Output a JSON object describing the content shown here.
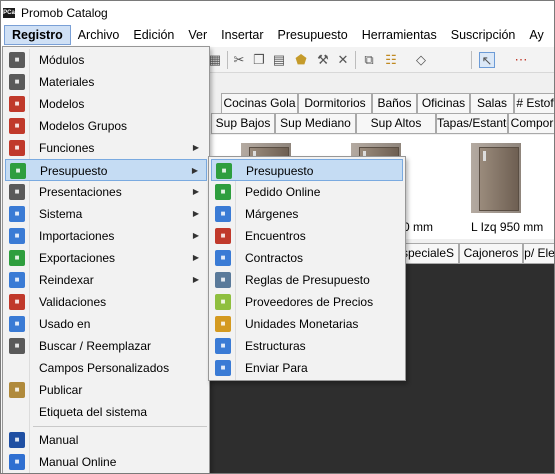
{
  "app": {
    "title": "Promob Catalog",
    "logo_text": "PCa"
  },
  "menubar": [
    "Registro",
    "Archivo",
    "Edición",
    "Ver",
    "Insertar",
    "Presupuesto",
    "Herramientas",
    "Suscripción",
    "Ay"
  ],
  "tabs_row1": [
    "Cocinas Gola",
    "Dormitorios",
    "Baños",
    "Oficinas",
    "Salas",
    "# Estof"
  ],
  "tabs_row2": [
    "Sup Bajos",
    "Sup Mediano",
    "Sup Altos",
    "Tapas/Estantes",
    "Compor"
  ],
  "tabs_row3": [
    "specialeS",
    "Cajoneros",
    "p/ Ele"
  ],
  "thumbs": {
    "label_partial": "0 mm",
    "label_right": "L Izq 950 mm"
  },
  "registro_menu": [
    {
      "label": "Módulos",
      "icon": "modules-icon",
      "color": "#5a5a5a"
    },
    {
      "label": "Materiales",
      "icon": "materials-icon",
      "color": "#5a5a5a"
    },
    {
      "label": "Modelos",
      "icon": "models-icon",
      "color": "#c0392b"
    },
    {
      "label": "Modelos Grupos",
      "icon": "model-groups-icon",
      "color": "#c0392b"
    },
    {
      "label": "Funciones",
      "icon": "functions-icon",
      "color": "#c0392b",
      "submenu": true
    },
    {
      "label": "Presupuesto",
      "icon": "budget-icon",
      "color": "#2e9e3e",
      "submenu": true,
      "highlighted": true
    },
    {
      "label": "Presentaciones",
      "icon": "presentations-icon",
      "color": "#5a5a5a",
      "submenu": true
    },
    {
      "label": "Sistema",
      "icon": "system-gear-icon",
      "color": "#3a7bd5",
      "submenu": true
    },
    {
      "label": "Importaciones",
      "icon": "import-icon",
      "color": "#3a7bd5",
      "submenu": true
    },
    {
      "label": "Exportaciones",
      "icon": "export-icon",
      "color": "#2e9e3e",
      "submenu": true
    },
    {
      "label": "Reindexar",
      "icon": "reindex-icon",
      "color": "#3a7bd5",
      "submenu": true
    },
    {
      "label": "Validaciones",
      "icon": "validations-icon",
      "color": "#c0392b"
    },
    {
      "label": "Usado en",
      "icon": "used-in-icon",
      "color": "#3a7bd5"
    },
    {
      "label": "Buscar / Reemplazar",
      "icon": "search-replace-icon",
      "color": "#5a5a5a"
    },
    {
      "label": "Campos Personalizados",
      "icon": "",
      "color": ""
    },
    {
      "label": "Publicar",
      "icon": "publish-icon",
      "color": "#b08a3c"
    },
    {
      "label": "Etiqueta del sistema",
      "icon": "",
      "color": ""
    },
    {
      "label": "Manual",
      "icon": "manual-book-icon",
      "color": "#1f4fa3",
      "sep_before": true
    },
    {
      "label": "Manual Online",
      "icon": "help-icon",
      "color": "#2f6fd1"
    }
  ],
  "presupuesto_submenu": [
    {
      "label": "Presupuesto",
      "icon": "budget-icon",
      "color": "#2e9e3e",
      "highlighted": true
    },
    {
      "label": "Pedido Online",
      "icon": "online-order-icon",
      "color": "#2e9e3e"
    },
    {
      "label": "Márgenes",
      "icon": "margins-icon",
      "color": "#3a7bd5"
    },
    {
      "label": "Encuentros",
      "icon": "joints-icon",
      "color": "#c0392b"
    },
    {
      "label": "Contractos",
      "icon": "contracts-icon",
      "color": "#3a7bd5"
    },
    {
      "label": "Reglas de Presupuesto",
      "icon": "budget-rules-icon",
      "color": "#5a7a9a"
    },
    {
      "label": "Proveedores de Precios",
      "icon": "price-providers-icon",
      "color": "#8fbf3f"
    },
    {
      "label": "Unidades Monetarias",
      "icon": "currency-units-icon",
      "color": "#d49a20"
    },
    {
      "label": "Estructuras",
      "icon": "structures-icon",
      "color": "#3a7bd5"
    },
    {
      "label": "Enviar Para",
      "icon": "send-to-icon",
      "color": "#3a7bd5"
    }
  ]
}
